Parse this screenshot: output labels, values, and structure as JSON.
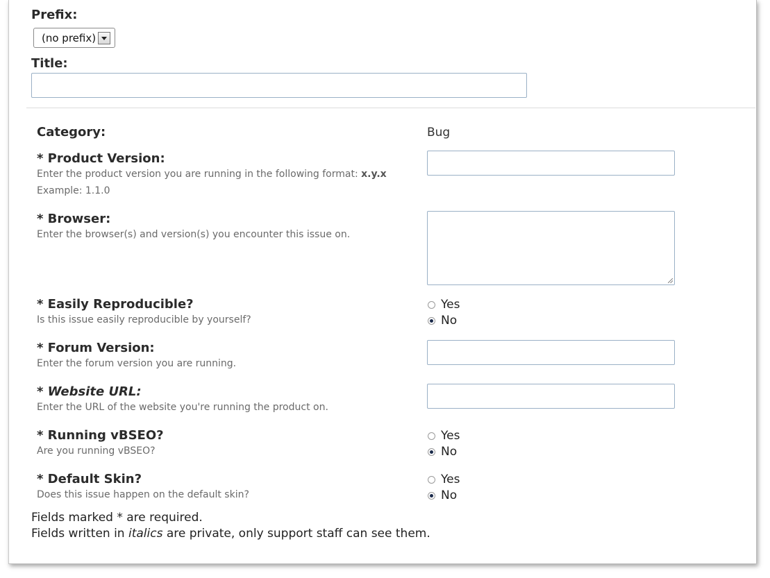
{
  "header": {
    "prefix_label": "Prefix:",
    "prefix_value": "(no prefix)",
    "title_label": "Title:",
    "title_value": ""
  },
  "fields": {
    "category": {
      "label": "Category:",
      "value": "Bug"
    },
    "product_version": {
      "label": "* Product Version:",
      "desc_prefix": "Enter the product version you are running in the following format: ",
      "desc_format": "x.y.x",
      "example": "Example: 1.1.0",
      "value": ""
    },
    "browser": {
      "label": "* Browser:",
      "desc": "Enter the browser(s) and version(s) you encounter this issue on.",
      "value": ""
    },
    "easily_reproducible": {
      "label": "* Easily Reproducible?",
      "desc": "Is this issue easily reproducible by yourself?",
      "yes": "Yes",
      "no": "No",
      "selected": "No"
    },
    "forum_version": {
      "label": "* Forum Version:",
      "desc": "Enter the forum version you are running.",
      "value": ""
    },
    "website_url": {
      "label": "* Website URL:",
      "desc": "Enter the URL of the website you're running the product on.",
      "value": ""
    },
    "running_vbseo": {
      "label": "* Running vBSEO?",
      "desc": "Are you running vBSEO?",
      "yes": "Yes",
      "no": "No",
      "selected": "No"
    },
    "default_skin": {
      "label": "* Default Skin?",
      "desc": "Does this issue happen on the default skin?",
      "yes": "Yes",
      "no": "No",
      "selected": "No"
    }
  },
  "footer": {
    "required_note": "Fields marked * are required.",
    "private_prefix": "Fields written in ",
    "private_italic": "italics",
    "private_suffix": " are private, only support staff can see them."
  }
}
